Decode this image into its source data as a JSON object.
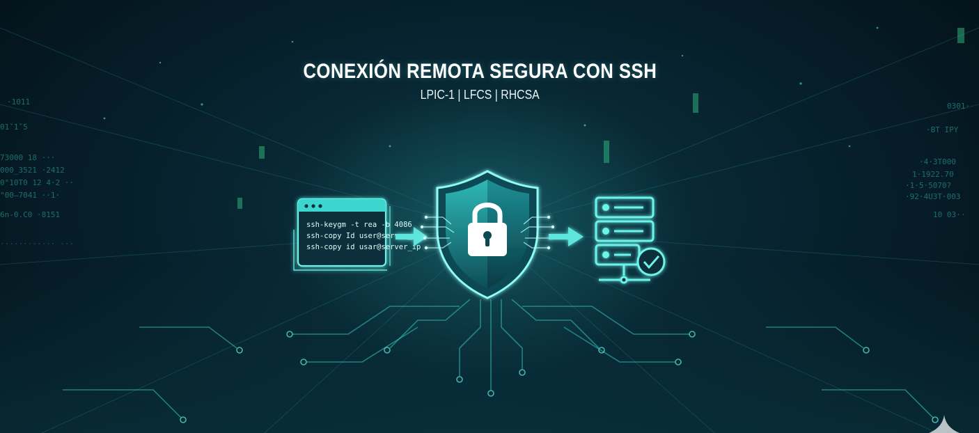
{
  "banner": {
    "title": "CONEXIÓN REMOTA SEGURA CON SSH",
    "subtitle": "LPIC-1 | LFCS | RHCSA"
  },
  "terminal": {
    "lines": [
      "ssh-keygm -t rea -b 4086",
      "ssh-copy Id user@server_ip",
      "ssh-copy id usar@server_ip"
    ]
  },
  "icons": {
    "terminal": "terminal-window-icon",
    "arrow": "right-arrow-icon",
    "shield": "shield-lock-icon",
    "server": "server-check-icon"
  },
  "colors": {
    "accent": "#4fe6dc",
    "glow": "#7ffaf2",
    "background": "#061a24"
  }
}
